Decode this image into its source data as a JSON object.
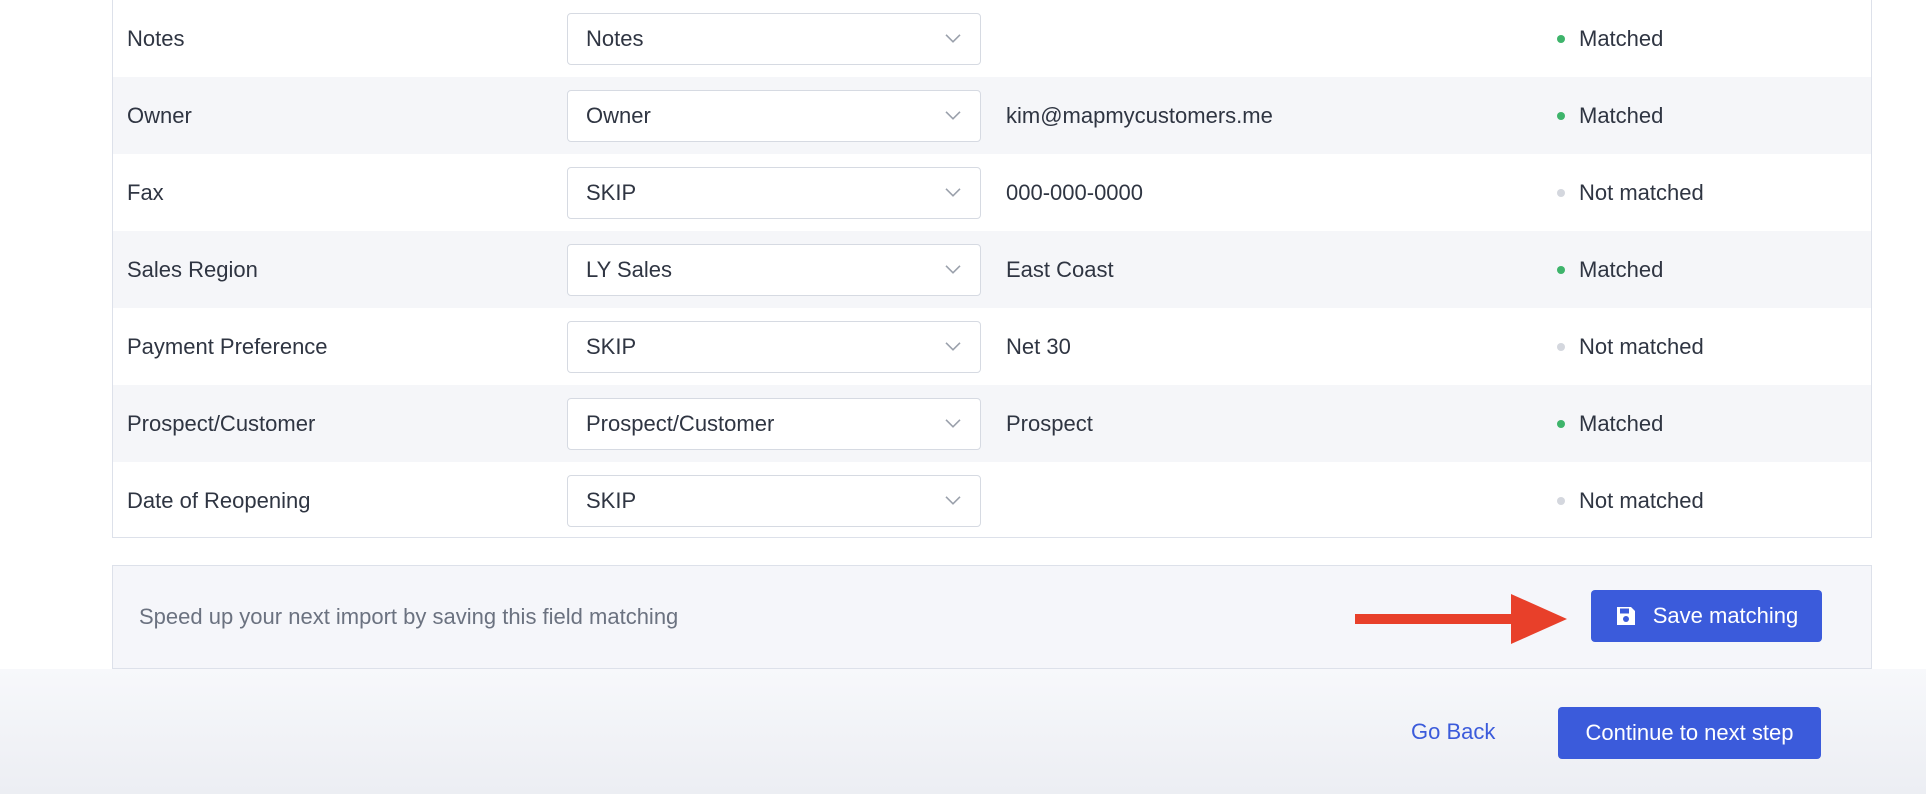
{
  "rows": [
    {
      "field": "Notes",
      "mapping": "Notes",
      "sample": "",
      "status": "Matched",
      "matched": true
    },
    {
      "field": "Owner",
      "mapping": "Owner",
      "sample": "kim@mapmycustomers.me",
      "status": "Matched",
      "matched": true
    },
    {
      "field": "Fax",
      "mapping": "SKIP",
      "sample": "000-000-0000",
      "status": "Not matched",
      "matched": false
    },
    {
      "field": "Sales Region",
      "mapping": "LY Sales",
      "sample": "East Coast",
      "status": "Matched",
      "matched": true
    },
    {
      "field": "Payment Preference",
      "mapping": "SKIP",
      "sample": "Net 30",
      "status": "Not matched",
      "matched": false
    },
    {
      "field": "Prospect/Customer",
      "mapping": "Prospect/Customer",
      "sample": "Prospect",
      "status": "Matched",
      "matched": true
    },
    {
      "field": "Date of Reopening",
      "mapping": "SKIP",
      "sample": "",
      "status": "Not matched",
      "matched": false
    }
  ],
  "save_bar": {
    "hint": "Speed up your next import by saving this field matching",
    "save_label": "Save matching",
    "save_icon": "floppy-disk-icon",
    "annotation_icon": "red-arrow-icon"
  },
  "footer": {
    "back_label": "Go Back",
    "continue_label": "Continue to next step"
  },
  "colors": {
    "accent": "#3b5bdb",
    "matched_dot": "#3eb46b",
    "unmatched_dot": "#d4d7de",
    "annotation_arrow": "#e8402a"
  }
}
